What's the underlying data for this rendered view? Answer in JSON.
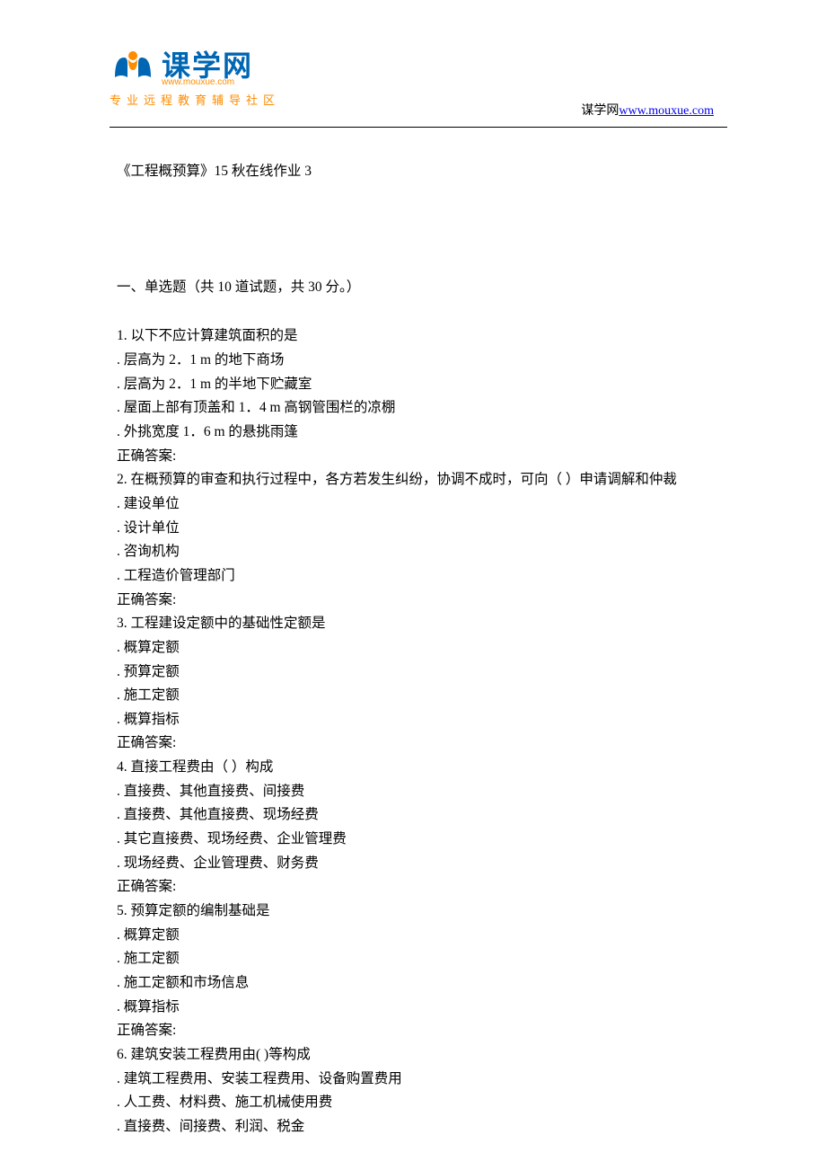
{
  "header": {
    "logo_name": "课学网",
    "logo_url": "www.mouxue.com",
    "logo_sub": "专业远程教育辅导社区",
    "site_label": "谋学网",
    "site_link": "www.mouxue.com"
  },
  "doc": {
    "title": "《工程概预算》15 秋在线作业 3",
    "section_header": "一、单选题（共 10 道试题，共 30 分。）",
    "correct_label": "正确答案:",
    "questions": [
      {
        "stem": "1.  以下不应计算建筑面积的是",
        "opts": [
          ".  层高为 2．1 m 的地下商场",
          ".  层高为 2．1 m 的半地下贮藏室",
          ".  屋面上部有顶盖和 1．4 m 高钢管围栏的凉棚",
          ".  外挑宽度 1．6 m 的悬挑雨篷"
        ]
      },
      {
        "stem": "2.  在概预算的审查和执行过程中，各方若发生纠纷，协调不成时，可向（ ）申请调解和仲裁",
        "opts": [
          ".  建设单位",
          ".  设计单位",
          ".  咨询机构",
          ".  工程造价管理部门"
        ]
      },
      {
        "stem": "3.  工程建设定额中的基础性定额是",
        "opts": [
          ".  概算定额",
          ".  预算定额",
          ".  施工定额",
          ".  概算指标"
        ]
      },
      {
        "stem": "4.  直接工程费由（ ）构成",
        "opts": [
          ".  直接费、其他直接费、间接费",
          ".  直接费、其他直接费、现场经费",
          ".  其它直接费、现场经费、企业管理费",
          ".  现场经费、企业管理费、财务费"
        ]
      },
      {
        "stem": "5.  预算定额的编制基础是",
        "opts": [
          ".  概算定额",
          ".  施工定额",
          ".  施工定额和市场信息",
          ".  概算指标"
        ]
      },
      {
        "stem": "6.  建筑安装工程费用由( )等构成",
        "opts": [
          ".  建筑工程费用、安装工程费用、设备购置费用",
          ".  人工费、材料费、施工机械使用费",
          ".  直接费、间接费、利润、税金"
        ]
      }
    ]
  }
}
